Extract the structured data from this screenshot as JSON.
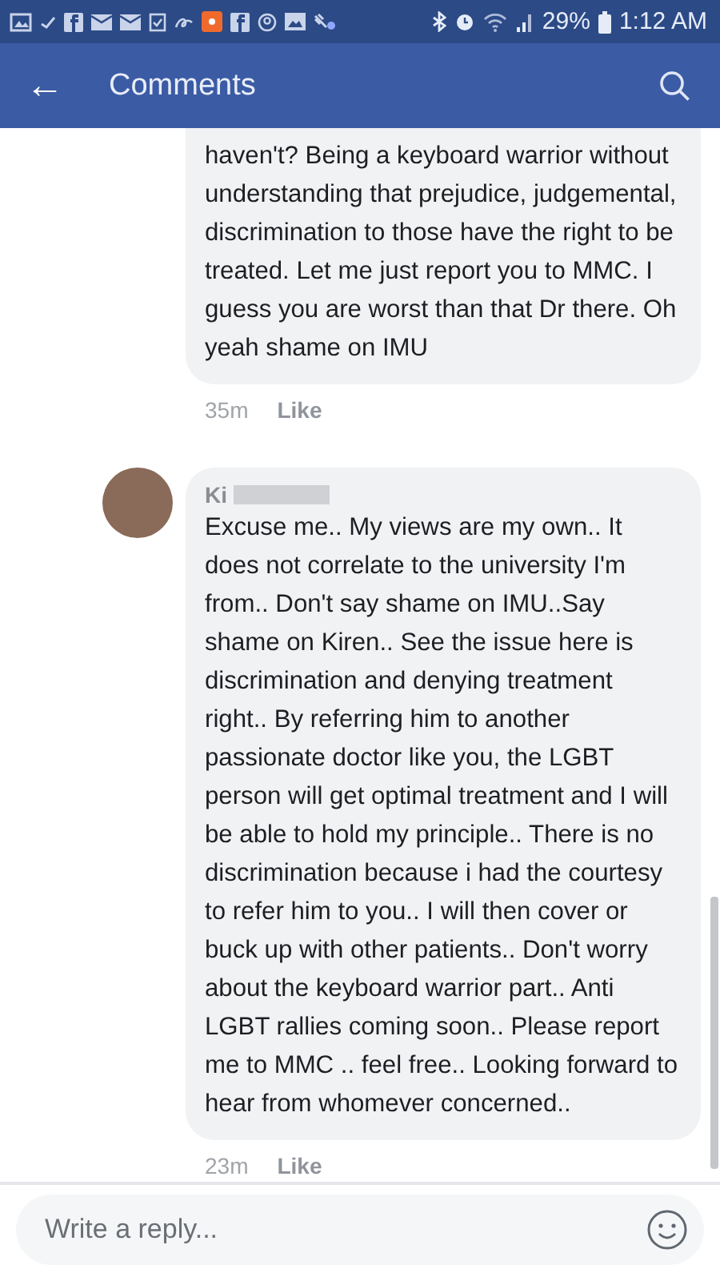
{
  "status_bar": {
    "battery": "29%",
    "time": "1:12 AM"
  },
  "header": {
    "back": "←",
    "title": "Comments"
  },
  "comments": [
    {
      "text": "haven't? Being a keyboard warrior without understanding that prejudice, judgemental, discrimination to those have the right to be treated. Let me just report you to MMC. I guess you are worst than that Dr there. Oh yeah shame on IMU",
      "time": "35m",
      "like": "Like"
    },
    {
      "author": "Ki",
      "text": "Excuse me.. My views are my own.. It does not correlate to the university I'm from.. Don't say shame on IMU..Say shame on Kiren.. See the issue here is discrimination and denying treatment right.. By referring him to another passionate doctor like you, the LGBT person will get optimal treatment and I will be able to hold my principle.. There is no discrimination because i had the courtesy to refer him to you.. I will then cover or buck up with other patients..  Don't worry about the keyboard warrior part.. Anti LGBT rallies coming soon.. Please report me to MMC .. feel free.. Looking forward to hear from whomever concerned..",
      "time": "23m",
      "like": "Like"
    }
  ],
  "reply": {
    "placeholder": "Write a reply..."
  }
}
